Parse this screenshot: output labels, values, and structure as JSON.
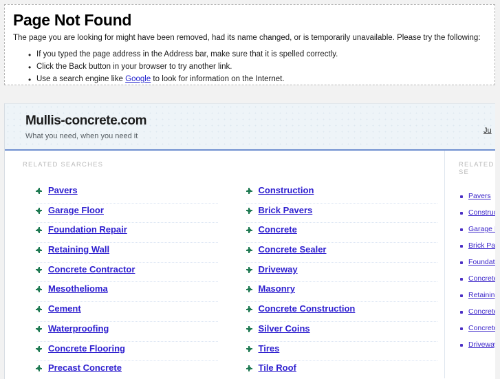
{
  "error": {
    "title": "Page Not Found",
    "description": "The page you are looking for might have been removed, had its name changed, or is temporarily unavailable. Please try the following:",
    "bullet_glyph": "•",
    "items": [
      {
        "text_before": "If you typed the page address in the Address bar, make sure that it is spelled correctly.",
        "link": "",
        "text_after": ""
      },
      {
        "text_before": "Click the Back button in your browser to try another link.",
        "link": "",
        "text_after": ""
      },
      {
        "text_before": "Use a search engine like ",
        "link": "Google",
        "text_after": " to look for information on the Internet."
      }
    ]
  },
  "site": {
    "title": "Mullis-concrete.com",
    "tagline": "What you need, when you need it",
    "corner_link": "Ju"
  },
  "main": {
    "section_label": "RELATED SEARCHES",
    "left_column": [
      "Pavers",
      "Garage Floor",
      "Foundation Repair",
      "Retaining Wall",
      "Concrete Contractor",
      "Mesothelioma",
      "Cement",
      "Waterproofing",
      "Concrete Flooring",
      "Precast Concrete"
    ],
    "right_column": [
      "Construction",
      "Brick Pavers",
      "Concrete",
      "Concrete Sealer",
      "Driveway",
      "Masonry",
      "Concrete Construction",
      "Silver Coins",
      "Tires",
      "Tile Roof"
    ]
  },
  "sidebar": {
    "section_label": "RELATED SE",
    "items": [
      "Pavers",
      "Construction",
      "Garage Floor",
      "Brick Pavers",
      "Foundation Repair",
      "Concrete",
      "Retaining Wall",
      "Concrete Sealer",
      "Concrete Contractor",
      "Driveway"
    ]
  },
  "colors": {
    "page_background": "#f2f2f2",
    "panel_background": "#ffffff",
    "header_background": "#eef4f8",
    "header_border": "#6f8fd0",
    "link": "#2d1ecf",
    "bullet_green": "#1f7a52",
    "label_gray": "#b9b9b9",
    "separator": "#dbe5f3"
  }
}
